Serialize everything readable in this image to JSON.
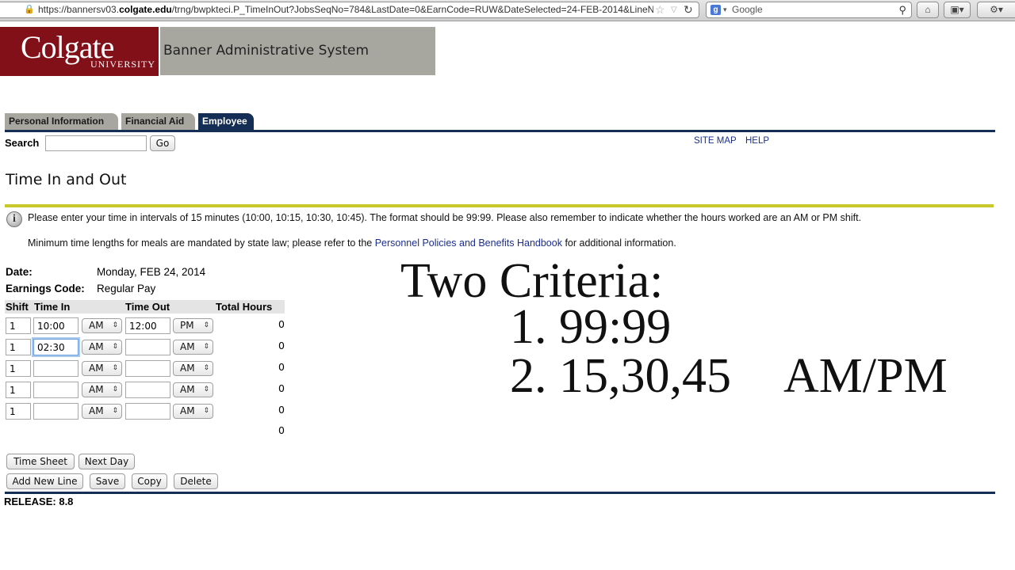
{
  "browser": {
    "url_prefix": "https://bannersv03.",
    "url_domain": "colgate.edu",
    "url_rest": "/trng/bwpkteci.P_TimeInOut?JobsSeqNo=784&LastDate=0&EarnCode=RUW&DateSelected=24-FEB-2014&LineN",
    "search_engine": "Google"
  },
  "header": {
    "logo_name": "Colgate",
    "logo_sub": "UNIVERSITY",
    "system_title": "Banner Administrative System"
  },
  "tabs": [
    {
      "label": "Personal Information"
    },
    {
      "label": "Financial Aid"
    },
    {
      "label": "Employee"
    }
  ],
  "search": {
    "label": "Search",
    "value": "",
    "go_label": "Go"
  },
  "links": {
    "site_map": "SITE MAP",
    "help": "HELP"
  },
  "page": {
    "title": "Time In and Out",
    "info_line1": "Please enter your time in intervals of 15 minutes (10:00, 10:15, 10:30, 10:45). The format should be 99:99. Please also remember to indicate whether the hours worked are an AM or PM shift.",
    "info_line2_pre": "Minimum time lengths for meals are mandated by state law; please refer to the ",
    "info_line2_link": "Personnel Policies and Benefits Handbook",
    "info_line2_post": " for additional information."
  },
  "form": {
    "date_label": "Date:",
    "date_value": "Monday, FEB 24, 2014",
    "earn_label": "Earnings Code:",
    "earn_value": "Regular Pay",
    "columns": {
      "shift": "Shift",
      "time_in": "Time In",
      "time_out": "Time Out",
      "total_hours": "Total Hours"
    },
    "rows": [
      {
        "shift": "1",
        "time_in": "10:00",
        "in_ampm": "AM",
        "time_out": "12:00",
        "out_ampm": "PM",
        "total": "0"
      },
      {
        "shift": "1",
        "time_in": "02:30",
        "in_ampm": "AM",
        "time_out": "",
        "out_ampm": "AM",
        "total": "0"
      },
      {
        "shift": "1",
        "time_in": "",
        "in_ampm": "AM",
        "time_out": "",
        "out_ampm": "AM",
        "total": "0"
      },
      {
        "shift": "1",
        "time_in": "",
        "in_ampm": "AM",
        "time_out": "",
        "out_ampm": "AM",
        "total": "0"
      },
      {
        "shift": "1",
        "time_in": "",
        "in_ampm": "AM",
        "time_out": "",
        "out_ampm": "AM",
        "total": "0"
      }
    ],
    "grand_total": "0"
  },
  "buttons": {
    "time_sheet": "Time Sheet",
    "next_day": "Next Day",
    "add_new_line": "Add New Line",
    "save": "Save",
    "copy": "Copy",
    "delete": "Delete"
  },
  "release": "RELEASE: 8.8",
  "overlay": {
    "heading": "Two Criteria:",
    "item1": "1. 99:99",
    "item2_num": "2. 15,30,45",
    "item2_ampm": "AM/PM"
  }
}
